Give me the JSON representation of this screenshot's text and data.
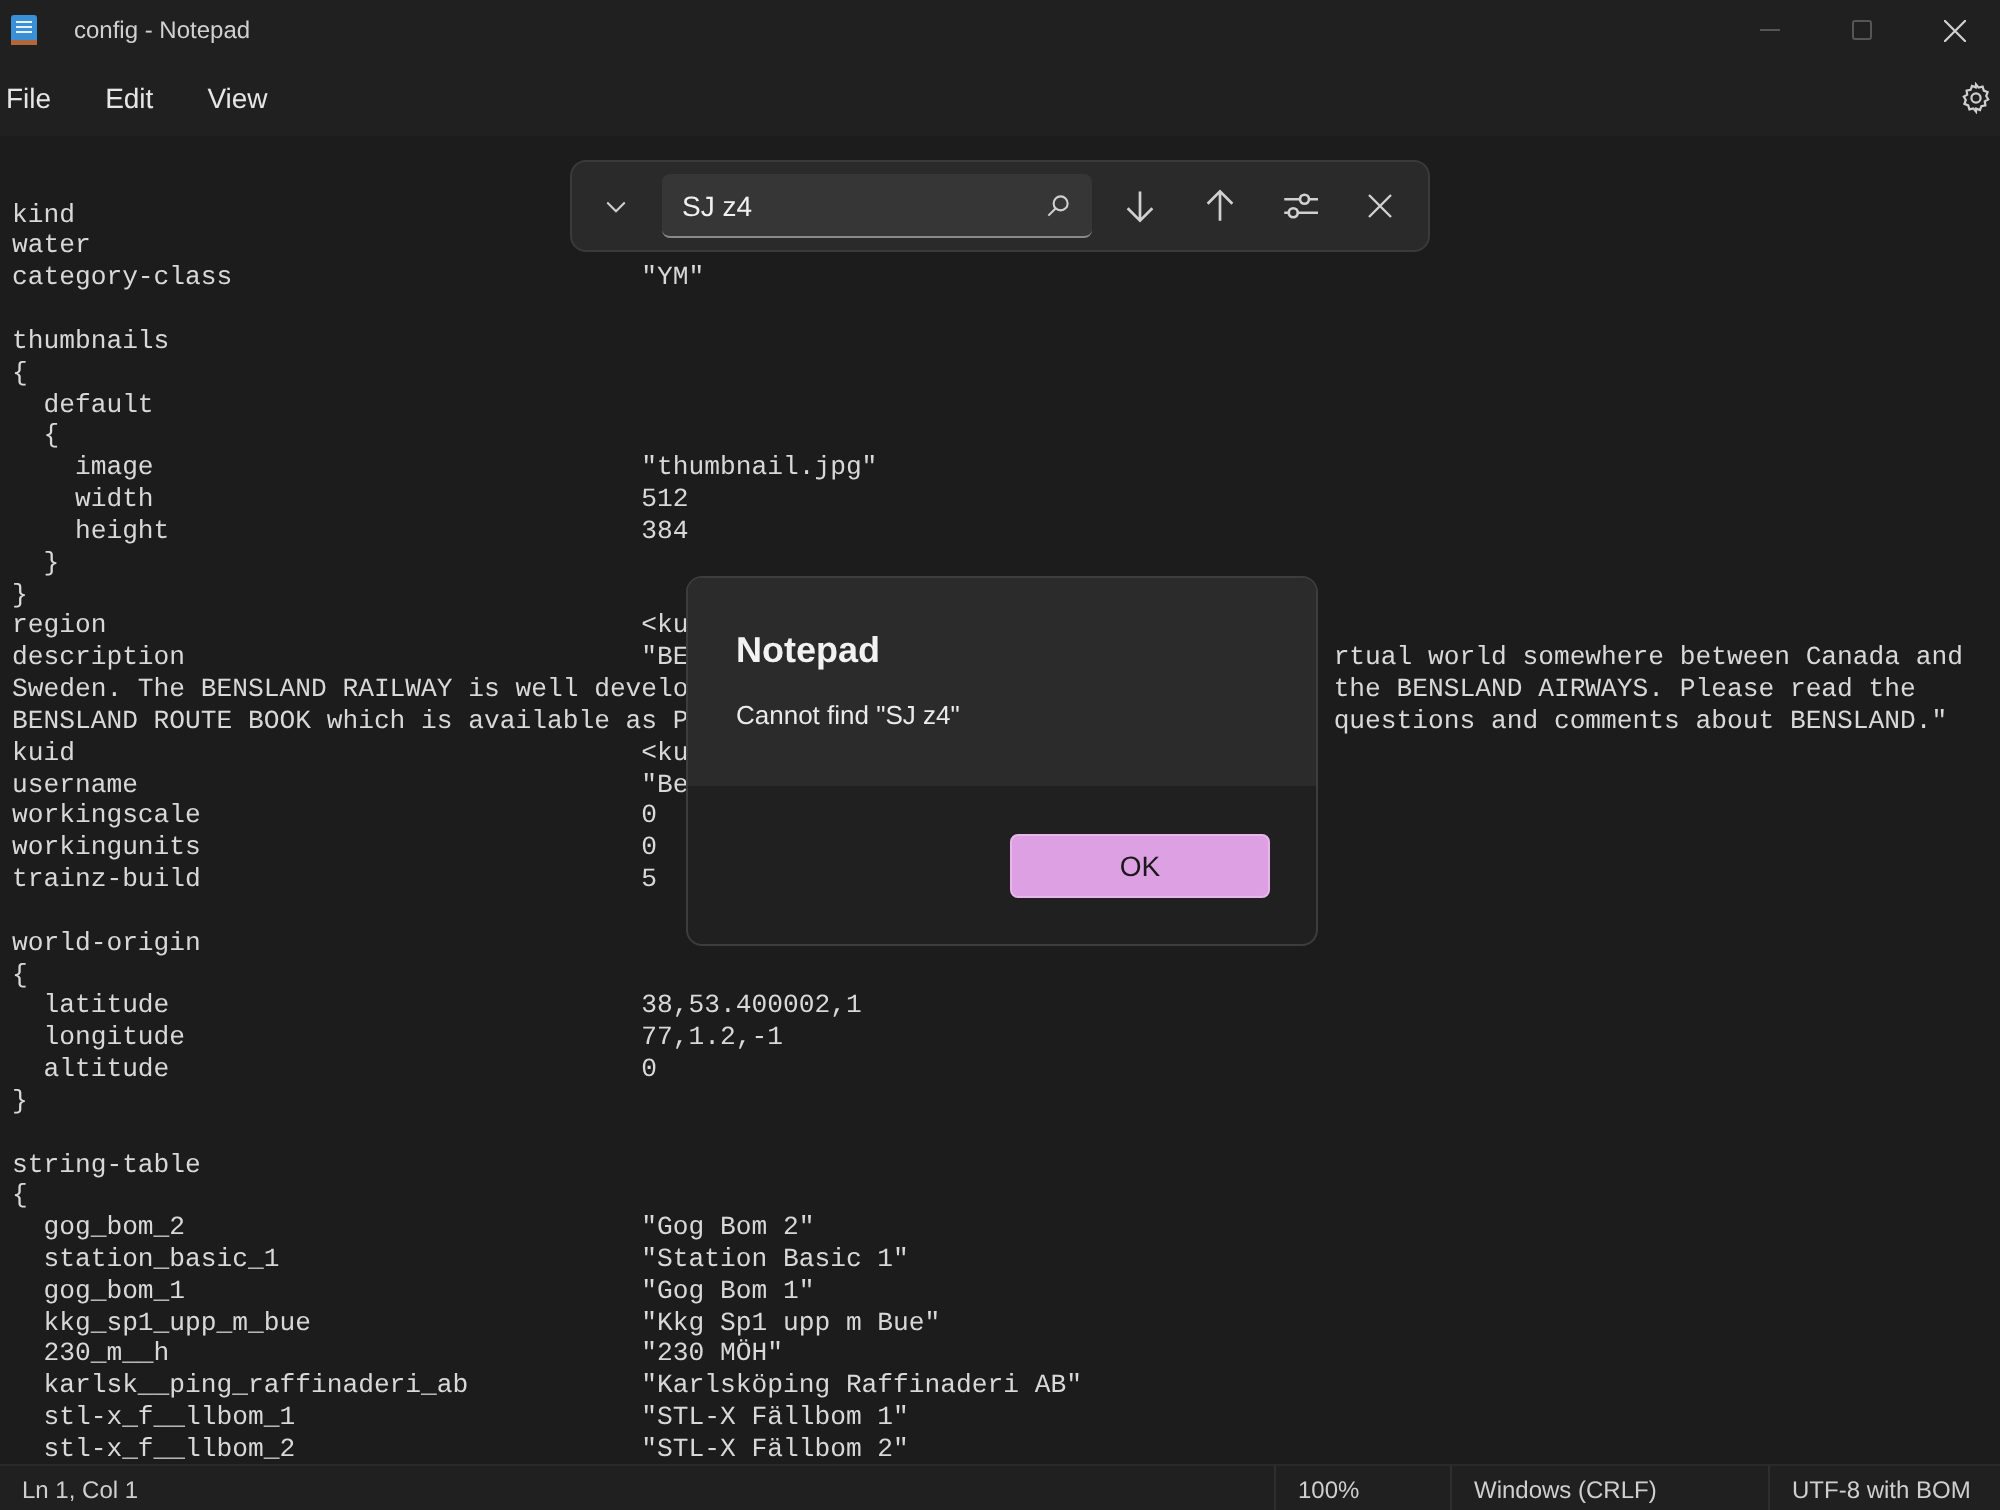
{
  "window": {
    "title": "config - Notepad"
  },
  "menu": [
    {
      "label": "File"
    },
    {
      "label": "Edit"
    },
    {
      "label": "View"
    }
  ],
  "editor": {
    "lines": [
      {
        "kind": "text",
        "key": "kind"
      },
      {
        "kind": "text",
        "key": "water"
      },
      {
        "kind": "text",
        "key": "category-class",
        "value": "\"YM\""
      },
      {
        "kind": "blank"
      },
      {
        "kind": "text",
        "key": "thumbnails"
      },
      {
        "kind": "text",
        "key": "{"
      },
      {
        "kind": "text",
        "key": "  default"
      },
      {
        "kind": "text",
        "key": "  {"
      },
      {
        "kind": "text",
        "key": "    image",
        "value": "\"thumbnail.jpg\""
      },
      {
        "kind": "text",
        "key": "    width",
        "value": "512"
      },
      {
        "kind": "text",
        "key": "    height",
        "value": "384"
      },
      {
        "kind": "text",
        "key": "  }"
      },
      {
        "kind": "text",
        "key": "}"
      },
      {
        "kind": "text",
        "key": "region",
        "value": "<ku"
      },
      {
        "kind": "text",
        "key": "description",
        "value": "\"BE",
        "tail": "rtual world somewhere between Canada and"
      },
      {
        "kind": "text",
        "key": "Sweden. The BENSLAND RAILWAY is well develo",
        "tail": "the BENSLAND AIRWAYS. Please read the"
      },
      {
        "kind": "text",
        "key": "BENSLAND ROUTE BOOK which is available as P",
        "tail": "questions and comments about BENSLAND.\""
      },
      {
        "kind": "text",
        "key": "kuid",
        "value": "<ku"
      },
      {
        "kind": "text",
        "key": "username",
        "value": "\"Be"
      },
      {
        "kind": "text",
        "key": "workingscale",
        "value": "0"
      },
      {
        "kind": "text",
        "key": "workingunits",
        "value": "0"
      },
      {
        "kind": "text",
        "key": "trainz-build",
        "value": "5"
      },
      {
        "kind": "blank"
      },
      {
        "kind": "text",
        "key": "world-origin"
      },
      {
        "kind": "text",
        "key": "{"
      },
      {
        "kind": "text",
        "key": "  latitude",
        "value": "38,53.400002,1"
      },
      {
        "kind": "text",
        "key": "  longitude",
        "value": "77,1.2,-1"
      },
      {
        "kind": "text",
        "key": "  altitude",
        "value": "0"
      },
      {
        "kind": "text",
        "key": "}"
      },
      {
        "kind": "blank"
      },
      {
        "kind": "text",
        "key": "string-table"
      },
      {
        "kind": "text",
        "key": "{"
      },
      {
        "kind": "text",
        "key": "  gog_bom_2",
        "value": "\"Gog Bom 2\""
      },
      {
        "kind": "text",
        "key": "  station_basic_1",
        "value": "\"Station Basic 1\""
      },
      {
        "kind": "text",
        "key": "  gog_bom_1",
        "value": "\"Gog Bom 1\""
      },
      {
        "kind": "text",
        "key": "  kkg_sp1_upp_m_bue",
        "value": "\"Kkg Sp1 upp m Bue\""
      },
      {
        "kind": "text",
        "key": "  230_m__h",
        "value": "\"230 MÖH\""
      },
      {
        "kind": "text",
        "key": "  karlsk__ping_raffinaderi_ab",
        "value": "\"Karlsköping Raffinaderi AB\""
      },
      {
        "kind": "text",
        "key": "  stl-x_f__llbom_1",
        "value": "\"STL-X Fällbom 1\""
      },
      {
        "kind": "text",
        "key": "  stl-x_f__llbom_2",
        "value": "\"STL-X Fällbom 2\""
      }
    ]
  },
  "find_bar": {
    "query": "SJ z4"
  },
  "dialog": {
    "title": "Notepad",
    "message": "Cannot find \"SJ z4\"",
    "button": "OK"
  },
  "status_bar": {
    "position": "Ln 1, Col 1",
    "zoom": "100%",
    "line_ending": "Windows (CRLF)",
    "encoding": "UTF-8 with BOM"
  }
}
